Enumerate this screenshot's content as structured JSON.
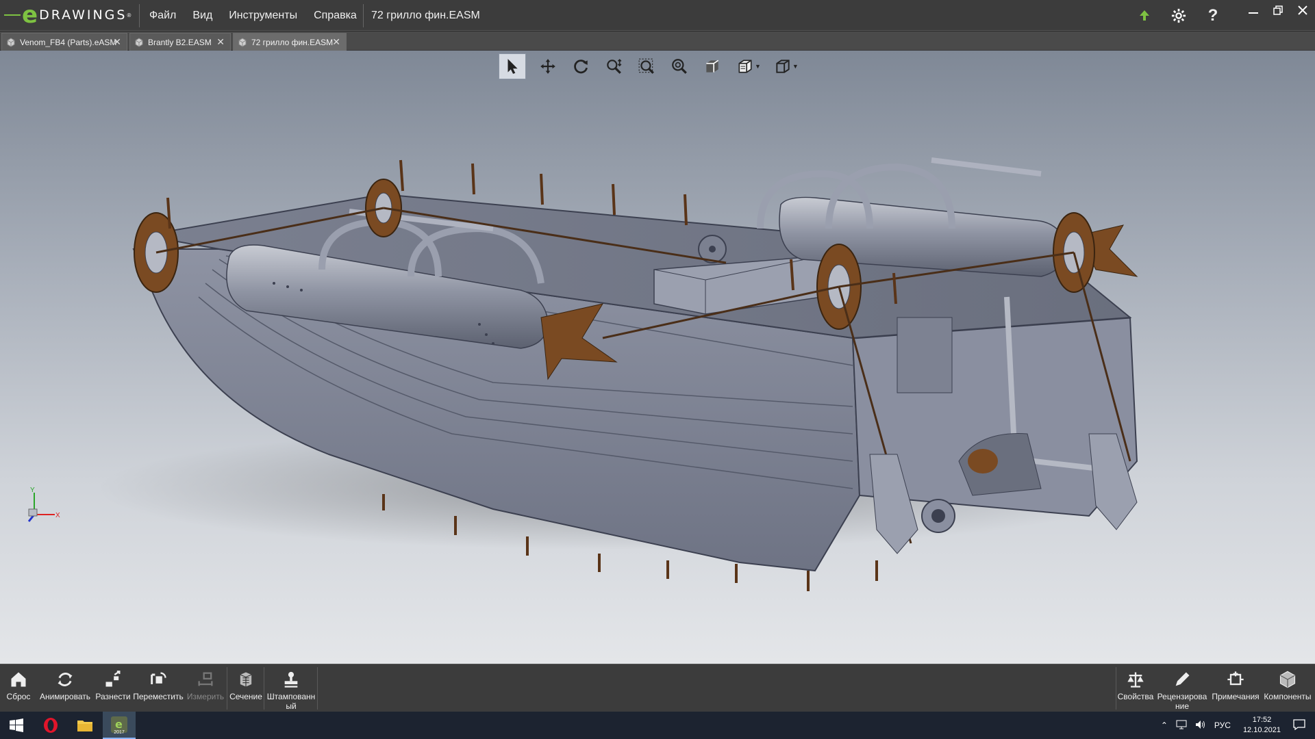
{
  "app": {
    "logo_letter": "e",
    "logo_word": "DRAWINGS",
    "logo_reg": "®",
    "document_title": "72 грилло фин.EASM",
    "accent_color": "#7ec242"
  },
  "menu": [
    "Файл",
    "Вид",
    "Инструменты",
    "Справка"
  ],
  "title_icons": [
    "upload-arrow-icon",
    "gear-icon",
    "help-icon"
  ],
  "window_controls": [
    "minimize-icon",
    "restore-icon",
    "close-icon"
  ],
  "tabs": [
    {
      "label": "Venom_FB4 (Parts).eASM",
      "active": false
    },
    {
      "label": "Brantly B2.EASM",
      "active": false
    },
    {
      "label": "72 грилло фин.EASM",
      "active": true
    }
  ],
  "view_toolbar": [
    "select-icon",
    "pan-icon",
    "rotate-icon",
    "zoom-icon",
    "zoom-area-icon",
    "zoom-fit-icon",
    "shaded-view-icon",
    "views-icon",
    "display-style-icon"
  ],
  "triad": {
    "y": "Y",
    "x": "X"
  },
  "bottom_left": [
    {
      "label": "Сброс",
      "icon": "home-icon",
      "enabled": true
    },
    {
      "label": "Анимировать",
      "icon": "animate-icon",
      "enabled": true
    },
    {
      "label": "Разнести",
      "icon": "explode-icon",
      "enabled": true
    },
    {
      "label": "Переместить",
      "icon": "move-icon",
      "enabled": true
    },
    {
      "label": "Измерить",
      "icon": "measure-icon",
      "enabled": false
    },
    {
      "label": "Сечение",
      "icon": "section-icon",
      "enabled": true
    },
    {
      "label": "Штампованн ый",
      "icon": "stamp-icon",
      "enabled": true
    }
  ],
  "bottom_right": [
    {
      "label": "Свойства",
      "icon": "scales-icon"
    },
    {
      "label": "Рецензирова ние",
      "icon": "pencil-icon"
    },
    {
      "label": "Примечания",
      "icon": "notes-icon"
    },
    {
      "label": "Компоненты",
      "icon": "components-icon"
    }
  ],
  "taskbar": {
    "apps": [
      "windows-start-icon",
      "opera-icon",
      "file-explorer-icon",
      "edrawings-taskbar-icon"
    ],
    "edrawings_label": "2017",
    "language": "РУС",
    "time": "17:52",
    "date": "12.10.2021"
  }
}
